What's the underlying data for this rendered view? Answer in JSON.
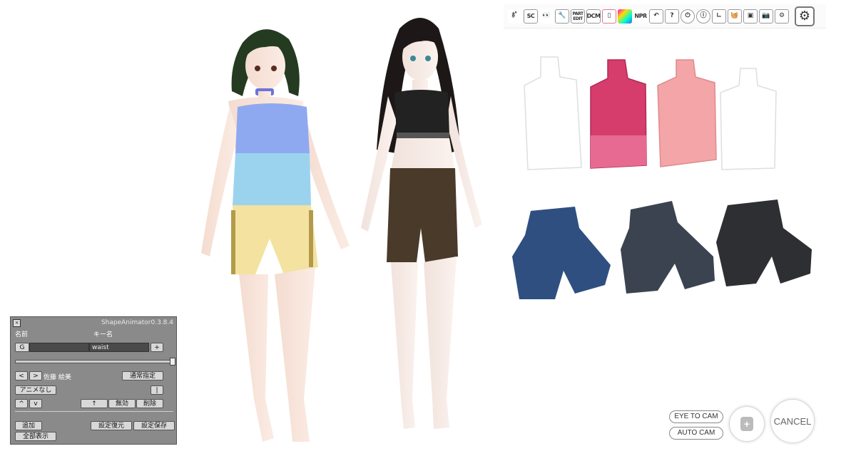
{
  "toolbar": {
    "buttons": [
      {
        "name": "pose-tool",
        "glyph": "ﾎﾟ"
      },
      {
        "name": "sc-tool",
        "glyph": "SC"
      },
      {
        "name": "eye-tool",
        "glyph": "👀"
      },
      {
        "name": "wrench-tool",
        "glyph": "🔧"
      },
      {
        "name": "part-edit",
        "glyph": "PART EDIT"
      },
      {
        "name": "dcm-tool",
        "glyph": "DCM"
      },
      {
        "name": "blank-tool",
        "glyph": "▯"
      },
      {
        "name": "color-tool",
        "glyph": ""
      },
      {
        "name": "npr-tool",
        "glyph": "NPR"
      },
      {
        "name": "undo",
        "glyph": "↶"
      },
      {
        "name": "help",
        "glyph": "?"
      },
      {
        "name": "power",
        "glyph": "⏻"
      },
      {
        "name": "info",
        "glyph": "ⓘ"
      },
      {
        "name": "axis",
        "glyph": "∟"
      },
      {
        "name": "basket",
        "glyph": "🧺"
      },
      {
        "name": "capture",
        "glyph": "▣"
      },
      {
        "name": "camera",
        "glyph": "📷"
      },
      {
        "name": "plugins",
        "glyph": "⚙"
      }
    ],
    "settings_glyph": "⚙"
  },
  "shape_animator": {
    "close": "×",
    "title": "ShapeAnimator0.3.8.4",
    "name_label": "名前",
    "key_label": "キー名",
    "group_button": "G",
    "name_value": "",
    "key_value": "waist",
    "plus_button": "+",
    "prev_button": "<",
    "next_button": ">",
    "character_name": "佐藤 絵美",
    "normal_spec_button": "通常指定",
    "anime_none_button": "アニメなし",
    "bar_button": "|",
    "up_small": "^",
    "down_small": "v",
    "arrow_up_button": "↑",
    "disable_button": "無効",
    "delete_button": "削除",
    "add_button": "追加",
    "show_all_button": "全部表示",
    "restore_button": "設定復元",
    "save_button": "設定保存"
  },
  "camera": {
    "eye_to_cam": "EYE TO CAM",
    "auto_cam": "AUTO CAM",
    "add_cam_glyph": "+",
    "cancel": "CANCEL"
  },
  "colors": {
    "top1": "#ffffff",
    "top2": "#d63c6c",
    "top3": "#f3a5a8",
    "top4": "#ffffff",
    "short1": "#2e4f80",
    "short2": "#3b4350",
    "short3": "#2e2f33",
    "char1_top_upper": "#8aa8f2",
    "char1_top_lower": "#98d2ee",
    "char1_shorts": "#f3e2a0",
    "char2_top": "#222222",
    "char2_shorts": "#4a3a2a",
    "hair1": "#233a20",
    "hair2": "#1a1614"
  }
}
